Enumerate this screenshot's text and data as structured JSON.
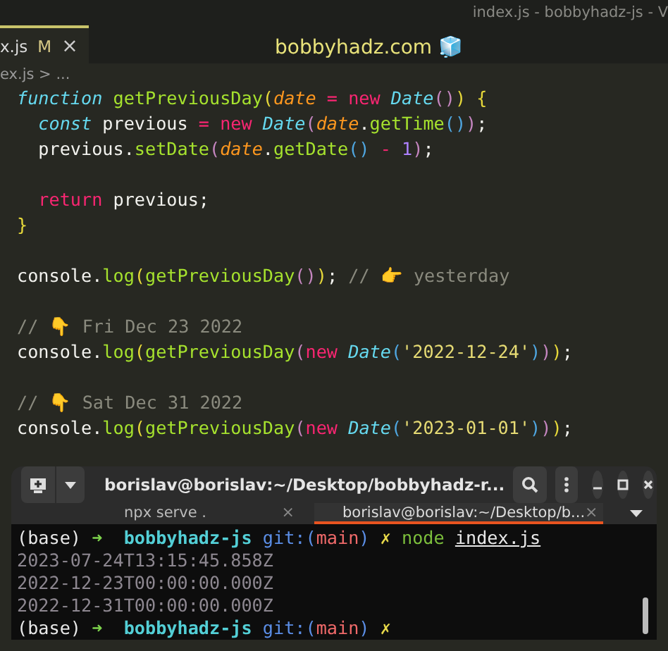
{
  "window": {
    "title": "index.js - bobbyhadz-js - V"
  },
  "editor_tab": {
    "label": "x.js",
    "status": "M",
    "close": "×",
    "selected": true
  },
  "watermark_title": "bobbyhadz.com 🧊",
  "breadcrumb": "ex.js > ...",
  "code_blocks": [
    [
      [
        {
          "t": "function ",
          "kind": "kw"
        },
        {
          "t": "getPreviousDay",
          "kind": "fn"
        },
        {
          "t": "(",
          "kind": "br1"
        },
        {
          "t": "date",
          "kind": "param"
        },
        {
          "t": " = new ",
          "kind": "op"
        },
        {
          "t": "Date",
          "kind": "cls"
        },
        {
          "t": "()",
          "kind": "br2"
        },
        {
          "t": ") {",
          "kind": "br1"
        }
      ],
      [
        {
          "t": "  const",
          "kind": "kw"
        },
        {
          "t": " previous ",
          "kind": "plain"
        },
        {
          "t": "= new ",
          "kind": "op"
        },
        {
          "t": "Date",
          "kind": "cls"
        },
        {
          "t": "(",
          "kind": "br2"
        },
        {
          "t": "date",
          "kind": "param"
        },
        {
          "t": ".",
          "kind": "plain"
        },
        {
          "t": "getTime",
          "kind": "fn"
        },
        {
          "t": "()",
          "kind": "br3"
        },
        {
          "t": ")",
          "kind": "br2"
        },
        {
          "t": ";",
          "kind": "plain"
        }
      ],
      [
        {
          "t": "  previous.",
          "kind": "plain"
        },
        {
          "t": "setDate",
          "kind": "fn"
        },
        {
          "t": "(",
          "kind": "br2"
        },
        {
          "t": "date",
          "kind": "param"
        },
        {
          "t": ".",
          "kind": "plain"
        },
        {
          "t": "getDate",
          "kind": "fn"
        },
        {
          "t": "()",
          "kind": "br3"
        },
        {
          "t": " - ",
          "kind": "op"
        },
        {
          "t": "1",
          "kind": "num"
        },
        {
          "t": ")",
          "kind": "br2"
        },
        {
          "t": ";",
          "kind": "plain"
        }
      ]
    ],
    [
      [
        {
          "t": "  return",
          "kind": "op"
        },
        {
          "t": " previous;",
          "kind": "plain"
        }
      ],
      [
        {
          "t": "}",
          "kind": "br1"
        }
      ]
    ],
    [
      [
        {
          "t": "console.",
          "kind": "plain"
        },
        {
          "t": "log",
          "kind": "fn"
        },
        {
          "t": "(",
          "kind": "br1"
        },
        {
          "t": "getPreviousDay",
          "kind": "fn"
        },
        {
          "t": "()",
          "kind": "br2"
        },
        {
          "t": ")",
          "kind": "br1"
        },
        {
          "t": "; ",
          "kind": "plain"
        },
        {
          "t": "// 👉 yesterday",
          "kind": "comment"
        }
      ]
    ],
    [
      [
        {
          "t": "// 👇 Fri Dec 23 2022",
          "kind": "comment"
        }
      ],
      [
        {
          "t": "console.",
          "kind": "plain"
        },
        {
          "t": "log",
          "kind": "fn"
        },
        {
          "t": "(",
          "kind": "br1"
        },
        {
          "t": "getPreviousDay",
          "kind": "fn"
        },
        {
          "t": "(",
          "kind": "br2"
        },
        {
          "t": "new ",
          "kind": "op"
        },
        {
          "t": "Date",
          "kind": "cls"
        },
        {
          "t": "(",
          "kind": "br3"
        },
        {
          "t": "'2022-12-24'",
          "kind": "str"
        },
        {
          "t": ")",
          "kind": "br3"
        },
        {
          "t": ")",
          "kind": "br2"
        },
        {
          "t": ")",
          "kind": "br1"
        },
        {
          "t": ";",
          "kind": "plain"
        }
      ]
    ],
    [
      [
        {
          "t": "// 👇 Sat Dec 31 2022",
          "kind": "comment"
        }
      ],
      [
        {
          "t": "console.",
          "kind": "plain"
        },
        {
          "t": "log",
          "kind": "fn"
        },
        {
          "t": "(",
          "kind": "br1"
        },
        {
          "t": "getPreviousDay",
          "kind": "fn"
        },
        {
          "t": "(",
          "kind": "br2"
        },
        {
          "t": "new ",
          "kind": "op"
        },
        {
          "t": "Date",
          "kind": "cls"
        },
        {
          "t": "(",
          "kind": "br3"
        },
        {
          "t": "'2023-01-01'",
          "kind": "str"
        },
        {
          "t": ")",
          "kind": "br3"
        },
        {
          "t": ")",
          "kind": "br2"
        },
        {
          "t": ")",
          "kind": "br1"
        },
        {
          "t": ";",
          "kind": "plain"
        }
      ]
    ]
  ],
  "terminal": {
    "title": "borislav@borislav:~/Desktop/bobbyhadz-r...",
    "tabs": [
      {
        "label": "npx serve .",
        "close": "×",
        "selected": false
      },
      {
        "label": "borislav@borislav:~/Desktop/b...",
        "close": "×",
        "selected": true
      }
    ],
    "lines": [
      [
        {
          "t": "(base) ",
          "kind": "plain"
        },
        {
          "t": "➜  ",
          "kind": "arrow"
        },
        {
          "t": "bobbyhadz-js ",
          "kind": "dir"
        },
        {
          "t": "git:(",
          "kind": "git"
        },
        {
          "t": "main",
          "kind": "branch"
        },
        {
          "t": ") ",
          "kind": "git"
        },
        {
          "t": "✗ ",
          "kind": "x"
        },
        {
          "t": "node ",
          "kind": "cmd"
        },
        {
          "t": "index.js",
          "kind": "file"
        }
      ],
      [
        {
          "t": "2023-07-24T13:15:45.858Z",
          "kind": "out"
        }
      ],
      [
        {
          "t": "2022-12-23T00:00:00.000Z",
          "kind": "out"
        }
      ],
      [
        {
          "t": "2022-12-31T00:00:00.000Z",
          "kind": "out"
        }
      ],
      [
        {
          "t": "(base) ",
          "kind": "plain"
        },
        {
          "t": "➜  ",
          "kind": "arrow"
        },
        {
          "t": "bobbyhadz-js ",
          "kind": "dir"
        },
        {
          "t": "git:(",
          "kind": "git"
        },
        {
          "t": "main",
          "kind": "branch"
        },
        {
          "t": ") ",
          "kind": "git"
        },
        {
          "t": "✗",
          "kind": "x"
        }
      ]
    ]
  }
}
